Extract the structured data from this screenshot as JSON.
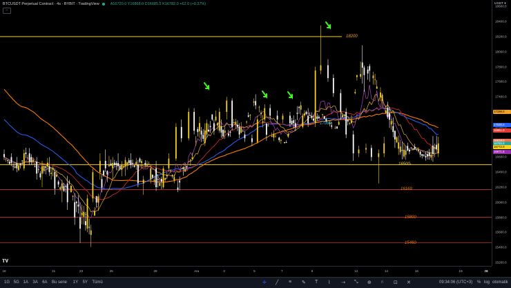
{
  "header": {
    "title": "BTCUSDT Perpetual Contract · 4s · BYBIT · TradingView",
    "ohlc": "A16720.0  Y16868.0  D16685.5  K16782.0  +62.0 (+0.37%)",
    "collapse_label": "−"
  },
  "currency": "USDT ▾",
  "price_axis": {
    "ticks": [
      "18600.0",
      "18400.0",
      "18200.0",
      "18000.0",
      "17800.0",
      "17600.0",
      "17400.0",
      "17200.0",
      "17000.0",
      "16800.0",
      "16600.0",
      "16400.0",
      "16200.0",
      "16000.0",
      "15800.0",
      "15600.0",
      "15400.0",
      "15200.0"
    ],
    "badges": [
      {
        "text": "17198.0",
        "color": "#f7a21b",
        "price": 17198
      },
      {
        "text": "17030.0",
        "color": "#2962ff",
        "price": 17030
      },
      {
        "text": "16951.0",
        "color": "#e53935",
        "price": 16951
      },
      {
        "text": "16819.0",
        "color": "#ff7043",
        "price": 16819
      },
      {
        "text": "16782.0",
        "color": "#26a69a",
        "price": 16782
      },
      {
        "text": "16772.0",
        "color": "#f7d21b",
        "price": 16735
      },
      {
        "text": "16671.5",
        "color": "#9c27b0",
        "price": 16672
      }
    ]
  },
  "time_axis": {
    "ticks": [
      {
        "label": "18",
        "i": 0
      },
      {
        "label": "21",
        "i": 18
      },
      {
        "label": "23",
        "i": 28
      },
      {
        "label": "25",
        "i": 39
      },
      {
        "label": "28",
        "i": 55
      },
      {
        "label": "Ara",
        "i": 70
      },
      {
        "label": "3",
        "i": 80
      },
      {
        "label": "5",
        "i": 91
      },
      {
        "label": "7",
        "i": 101
      },
      {
        "label": "9",
        "i": 112
      },
      {
        "label": "12",
        "i": 128
      },
      {
        "label": "14",
        "i": 139
      },
      {
        "label": "16",
        "i": 150
      },
      {
        "label": "19",
        "i": 166
      },
      {
        "label": "21",
        "i": 176
      },
      {
        "label": "23",
        "i": 187
      },
      {
        "label": "26",
        "i": 203
      },
      {
        "label": "28",
        "i": 213
      }
    ]
  },
  "levels": [
    {
      "price": 18200,
      "label": "18200",
      "color": "#f7d21b"
    },
    {
      "price": 16500,
      "label": "16500-",
      "color": "#f7d21b"
    },
    {
      "price": 16169,
      "label": "16169",
      "color": "#e53935"
    },
    {
      "price": 15800,
      "label": "15800",
      "color": "#e53935"
    },
    {
      "price": 15460,
      "label": "15460",
      "color": "#e53935"
    }
  ],
  "annotations": [
    {
      "text": "17080",
      "color": "#29b6f6"
    }
  ],
  "chart_data": {
    "type": "candlestick",
    "ylim": [
      15200,
      18650
    ],
    "ohlc_sampled": [
      [
        16640,
        16700,
        16560,
        16600
      ],
      [
        16600,
        16650,
        16480,
        16520
      ],
      [
        16520,
        16600,
        16400,
        16450
      ],
      [
        16450,
        16700,
        16420,
        16650
      ],
      [
        16650,
        16720,
        16500,
        16540
      ],
      [
        16540,
        16600,
        16300,
        16380
      ],
      [
        16380,
        16550,
        16200,
        16480
      ],
      [
        16480,
        16600,
        16350,
        16400
      ],
      [
        16400,
        16450,
        16100,
        16180
      ],
      [
        16180,
        16300,
        16000,
        16250
      ],
      [
        16250,
        16350,
        15900,
        16000
      ],
      [
        16000,
        16120,
        15700,
        15800
      ],
      [
        15800,
        16000,
        15460,
        15650
      ],
      [
        15650,
        16100,
        15600,
        16050
      ],
      [
        16050,
        16450,
        16000,
        16400
      ],
      [
        16400,
        16650,
        16300,
        16550
      ],
      [
        16550,
        16700,
        16400,
        16450
      ],
      [
        16450,
        16600,
        16300,
        16520
      ],
      [
        16520,
        16650,
        16420,
        16480
      ],
      [
        16480,
        16600,
        16350,
        16560
      ],
      [
        16560,
        16650,
        16450,
        16500
      ],
      [
        16500,
        16560,
        16200,
        16250
      ],
      [
        16250,
        16350,
        16100,
        16300
      ],
      [
        16300,
        16500,
        16250,
        16450
      ],
      [
        16450,
        16550,
        16150,
        16200
      ],
      [
        16200,
        16480,
        16180,
        16450
      ],
      [
        16450,
        16650,
        16400,
        16580
      ],
      [
        16580,
        17050,
        16550,
        17000
      ],
      [
        17000,
        17100,
        16800,
        16850
      ],
      [
        16850,
        17250,
        16820,
        17200
      ],
      [
        17200,
        17250,
        16900,
        16950
      ],
      [
        16950,
        17000,
        16800,
        16900
      ],
      [
        16900,
        17100,
        16850,
        17050
      ],
      [
        17050,
        17100,
        16900,
        16950
      ],
      [
        16950,
        17250,
        16920,
        17200
      ],
      [
        17200,
        17400,
        17100,
        17350
      ],
      [
        17350,
        17380,
        16950,
        17000
      ],
      [
        17000,
        17050,
        16850,
        16900
      ],
      [
        16900,
        16950,
        16800,
        16850
      ],
      [
        16850,
        16900,
        16750,
        16800
      ],
      [
        16800,
        17150,
        16780,
        17100
      ],
      [
        17100,
        17300,
        17050,
        17250
      ],
      [
        17250,
        17300,
        17100,
        17150
      ],
      [
        17150,
        17220,
        17050,
        17100
      ],
      [
        17100,
        17180,
        17050,
        17150
      ],
      [
        17150,
        17200,
        17000,
        17050
      ],
      [
        17050,
        17100,
        16950,
        17000
      ],
      [
        17000,
        17180,
        16980,
        17150
      ],
      [
        17150,
        17250,
        17000,
        17050
      ],
      [
        17050,
        17800,
        17000,
        17750
      ],
      [
        17750,
        18350,
        17700,
        17820
      ],
      [
        17820,
        17900,
        17600,
        17650
      ],
      [
        17650,
        17700,
        17400,
        17450
      ],
      [
        17450,
        17500,
        17100,
        17200
      ],
      [
        17200,
        17250,
        16850,
        16900
      ],
      [
        16900,
        16950,
        16550,
        16650
      ],
      [
        16650,
        16750,
        16600,
        16700
      ],
      [
        16700,
        16780,
        16650,
        16720
      ],
      [
        16720,
        16760,
        16550,
        16600
      ],
      [
        16600,
        16700,
        16250,
        16650
      ],
      [
        16650,
        16870,
        16600,
        16782
      ]
    ]
  },
  "bottom_bar": {
    "timeframes": [
      "1G",
      "5G",
      "1A",
      "3A",
      "6A",
      "Bu sene",
      "1Y",
      "5Y",
      "Tümü"
    ],
    "tool_icons": [
      "crosshair-icon",
      "trend-line-icon",
      "fib-icon",
      "brush-icon",
      "text-icon",
      "pattern-icon",
      "prediction-icon",
      "measure-icon",
      "zoom-icon",
      "magnet-icon",
      "lock-icon",
      "trash-icon"
    ],
    "clock": "09:34:06 (UTC+3)",
    "percent_label": "%",
    "log_label": "log",
    "auto_label": "otomatik"
  },
  "colors": {
    "up": "#f7d21b",
    "down": "#ffffff",
    "bg": "#000000",
    "ma_orange": "#f57c00",
    "ma_blue": "#2962ff",
    "ma_red": "#c62828",
    "ma_purple": "#ab47bc",
    "arrow": "#39ff14"
  }
}
